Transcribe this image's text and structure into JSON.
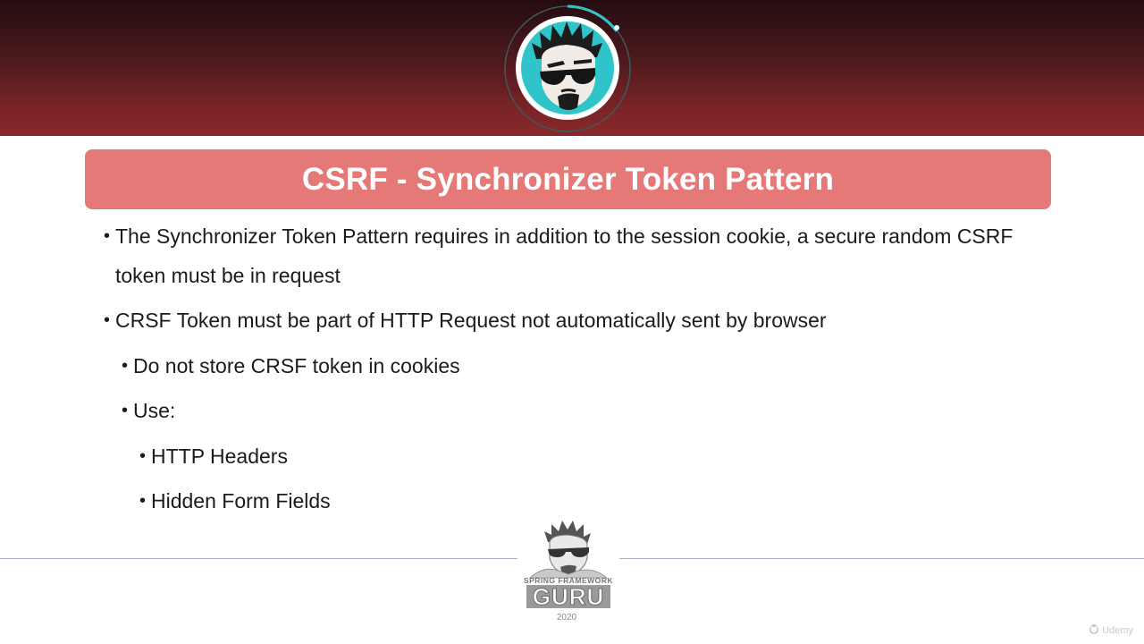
{
  "slide": {
    "title": "CSRF - Synchronizer Token Pattern",
    "bullets": [
      {
        "level": 1,
        "line1": "The Synchronizer Token Pattern requires in addition to the session cookie, a secure random CSRF",
        "line2": "token must be in request"
      },
      {
        "level": 1,
        "text": "CRSF Token must be part of HTTP Request not automatically sent by browser"
      },
      {
        "level": 2,
        "text": "Do not store CRSF token in cookies"
      },
      {
        "level": 2,
        "text": "Use:"
      },
      {
        "level": 3,
        "text": "HTTP Headers"
      },
      {
        "level": 3,
        "text": "Hidden Form Fields"
      }
    ],
    "bullet_glyph": "•"
  },
  "footer": {
    "logo_top_text": "SPRING FRAMEWORK",
    "logo_main_text": "GURU",
    "logo_year": "2020",
    "watermark": "Udemy"
  },
  "colors": {
    "banner_dark": "#240c10",
    "banner_light": "#8a292b",
    "title_bar": "#e57978",
    "title_text": "#ffffff",
    "body_text": "#1b1b1b",
    "avatar_ring": "#36c3c6",
    "avatar_bg": "#2ec4c9"
  },
  "icons": {
    "header_avatar": "guru-avatar-icon",
    "footer_logo": "spring-framework-guru-logo",
    "watermark": "udemy-logo-icon"
  }
}
